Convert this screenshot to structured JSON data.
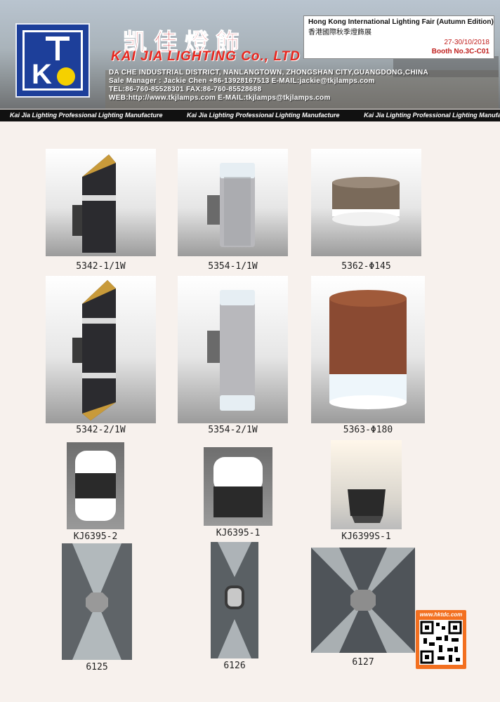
{
  "company": {
    "name_cn": "凯佳燈飾",
    "name_en": "KAI JIA LIGHTING Co., LTD",
    "address": "DA CHE INDUSTRIAL DISTRICT, NANLANGTOWN, ZHONGSHAN CITY,GUANGDONG,CHINA",
    "sales": "Sale Manager : Jackie Chen  +86-13928167513  E-MAIL:jackie@tkjlamps.com",
    "tel": "TEL:86-760-85528301 FAX:86-760-85528688",
    "web": "WEB:http://www.tkjlamps.com  E-MAIL:tkjlamps@tkjlamps.com"
  },
  "fair": {
    "title_en": "Hong Kong International Lighting Fair (Autumn Edition)",
    "title_cn": "香港國際秋季燈飾展",
    "dates": "27-30/10/2018",
    "booth": "Booth No.3C-C01"
  },
  "ticker": [
    "Kai Jia Lighting  Professional Lighting Manufacture",
    "Kai Jia Lighting  Professional Lighting Manufacture",
    "Kai Jia Lighting  Professional Lighting Manufacture"
  ],
  "products": [
    "5342-1/1W",
    "5354-1/1W",
    "5362-Φ145",
    "5342-2/1W",
    "5354-2/1W",
    "5363-Φ180",
    "KJ6395-2",
    "KJ6395-1",
    "KJ6399S-1",
    "6125",
    "6126",
    "6127"
  ],
  "qr": {
    "url": "www.hktdc.com"
  },
  "colors": {
    "brand_red": "#d0202a",
    "logo_blue": "#1d3f9a",
    "qr_orange": "#f37020"
  }
}
